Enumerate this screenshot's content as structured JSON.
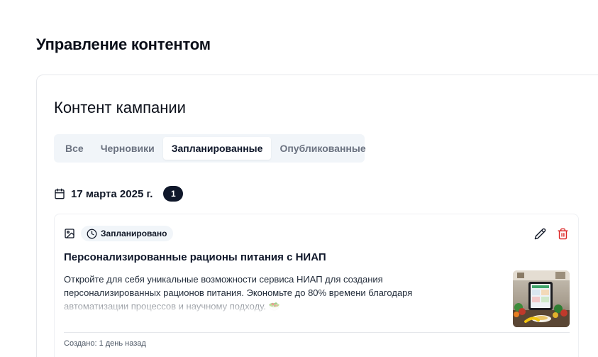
{
  "page": {
    "title": "Управление контентом"
  },
  "card": {
    "title": "Контент кампании",
    "tabs": [
      {
        "label": "Все",
        "active": false
      },
      {
        "label": "Черновики",
        "active": false
      },
      {
        "label": "Запланированные",
        "active": true
      },
      {
        "label": "Опубликованные",
        "active": false
      }
    ]
  },
  "group": {
    "date": "17 марта 2025 г.",
    "count": "1"
  },
  "item": {
    "status": "Запланировано",
    "title": "Персонализированные рационы питания с НИАП",
    "description": "Откройте для себя уникальные возможности сервиса НИАП для создания персонализированных рационов питания. Экономьте до 80% времени благодаря автоматизации процессов и научному подходу. 🥗",
    "created": "Создано: 1 день назад"
  },
  "colors": {
    "accent": "#0f172a",
    "danger": "#dc2626",
    "tab_bg": "#f1f5f9"
  },
  "icons": [
    "calendar-icon",
    "image-icon",
    "clock-icon",
    "pencil-icon",
    "trash-icon"
  ]
}
